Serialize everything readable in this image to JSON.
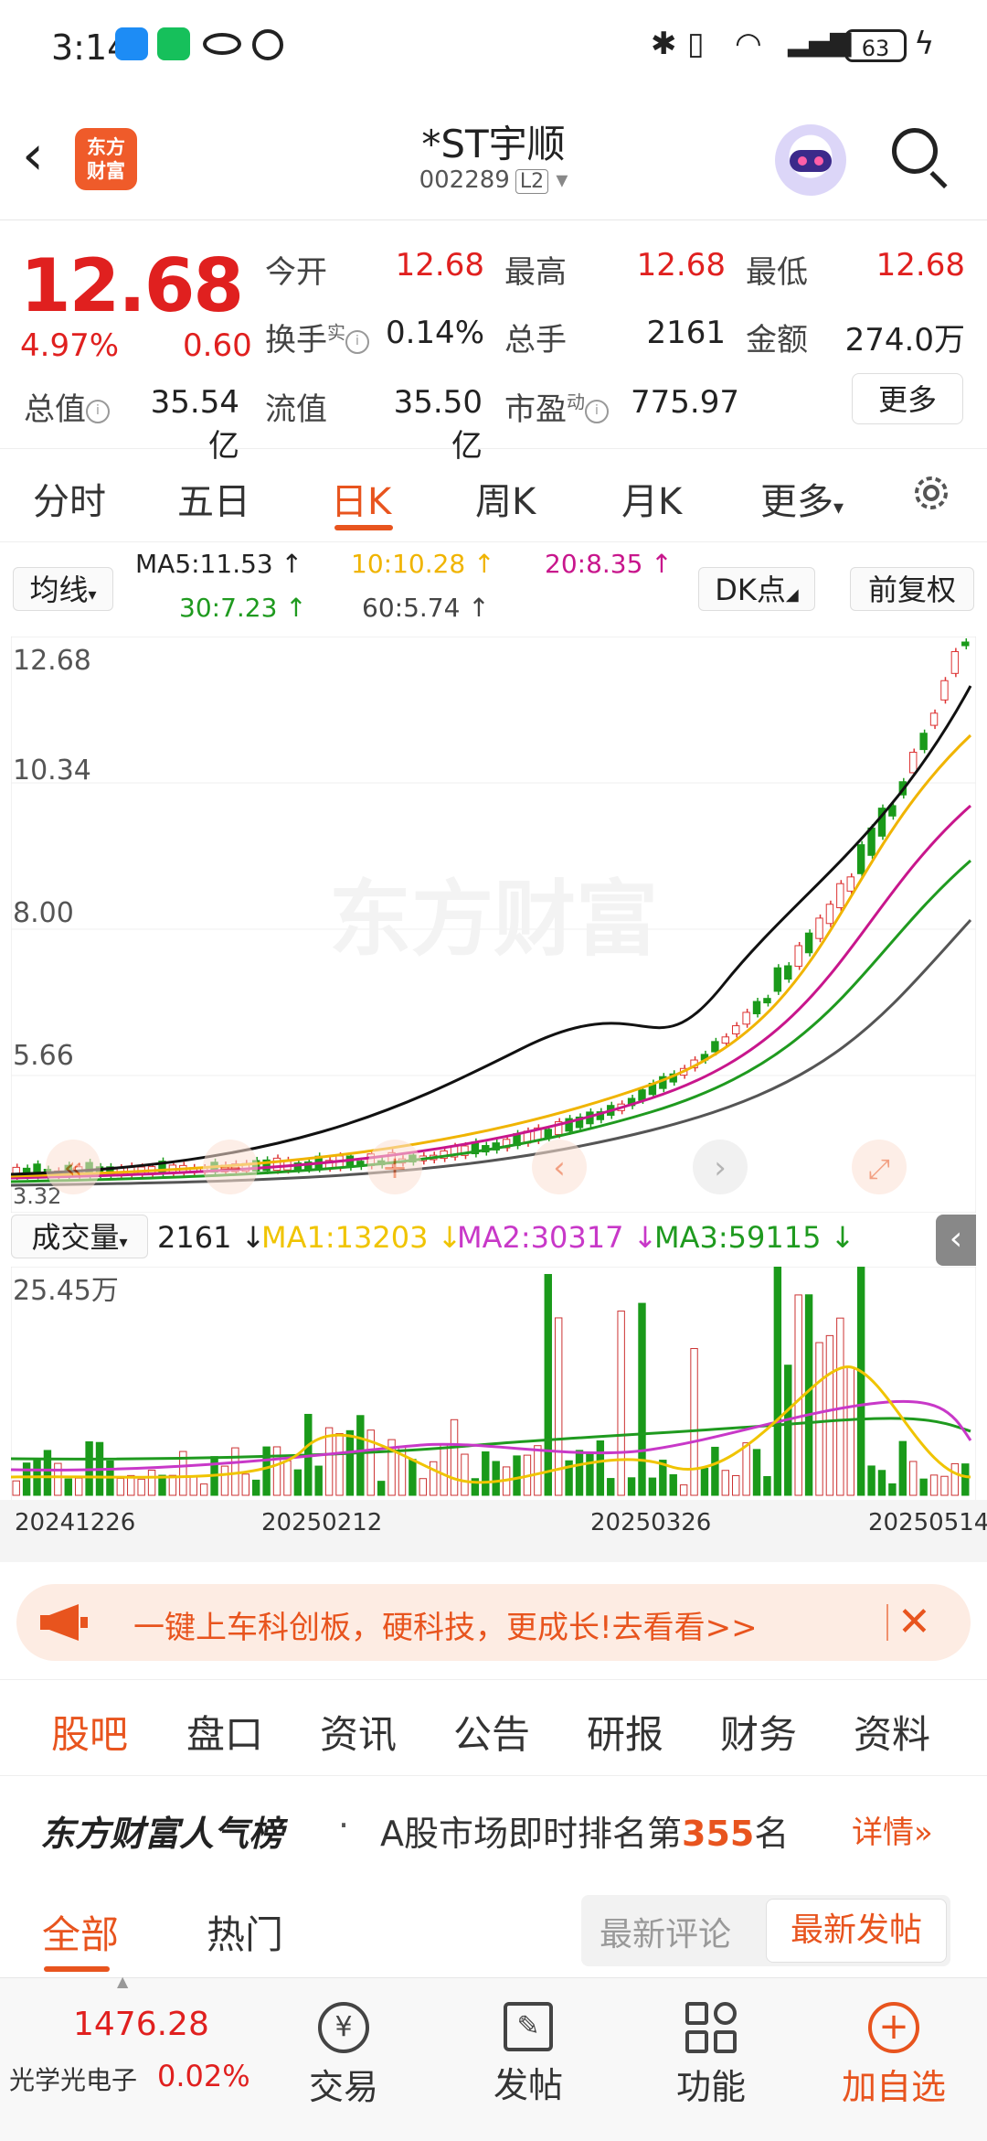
{
  "status_bar": {
    "time": "3:14",
    "battery": "63"
  },
  "header": {
    "back_icon": "chevron-left-icon",
    "logo_text": "东方\n财富",
    "stock_name": "*ST宇顺",
    "stock_code": "002289",
    "level_badge": "L2"
  },
  "quote": {
    "price": "12.68",
    "change_pct": "4.97%",
    "change": "0.60",
    "fields": {
      "open_label": "今开",
      "open": "12.68",
      "high_label": "最高",
      "high": "12.68",
      "low_label": "最低",
      "low": "12.68",
      "turnover_label": "换手",
      "turnover_sup": "实",
      "turnover": "0.14%",
      "volume_label": "总手",
      "volume": "2161",
      "amount_label": "金额",
      "amount": "274.0万",
      "mktcap_label": "总值",
      "mktcap": "35.54亿",
      "float_label": "流值",
      "float_cap": "35.50亿",
      "pe_label": "市盈",
      "pe_sup": "动",
      "pe": "775.97"
    },
    "more_label": "更多"
  },
  "chart_tabs": [
    "分时",
    "五日",
    "日K",
    "周K",
    "月K",
    "更多"
  ],
  "active_chart_tab": "日K",
  "ma_row": {
    "ma_select": "均线",
    "ma5": "MA5:11.53 ↑",
    "ma10": "10:10.28 ↑",
    "ma20": "20:8.35 ↑",
    "ma30": "30:7.23 ↑",
    "ma60": "60:5.74 ↑",
    "dk_button": "DK点",
    "adjust_button": "前复权",
    "colors": {
      "ma5": "#222222",
      "ma10": "#f0b400",
      "ma20": "#c8168c",
      "ma30": "#1f9a1f",
      "ma60": "#555555"
    }
  },
  "kchart": {
    "y_labels": [
      "12.68",
      "10.34",
      "8.00",
      "5.66"
    ],
    "bottom_label": "3.32",
    "watermark": "东方财富"
  },
  "volume": {
    "select": "成交量",
    "current": "2161 ↓",
    "ma1": "MA1:13203 ↓",
    "ma2": "MA2:30317 ↓",
    "ma3": "MA3:59115 ↓",
    "max_label": "25.45万",
    "colors": {
      "ma1": "#f0c400",
      "ma2": "#c838c8",
      "ma3": "#1f9a1f"
    }
  },
  "dates": [
    "20241226",
    "20250212",
    "20250326",
    "20250514"
  ],
  "banner": {
    "text": "一键上车科创板，硬科技，更成长!去看看>>"
  },
  "feature_tabs": [
    "股吧",
    "盘口",
    "资讯",
    "公告",
    "研报",
    "财务",
    "资料"
  ],
  "active_feature_tab": "股吧",
  "rank": {
    "title": "东方财富人气榜",
    "dot": "·",
    "text_before": "A股市场即时排名第",
    "rank": "355",
    "text_after": "名",
    "detail": "详情"
  },
  "sub_tabs": {
    "all": "全部",
    "hot": "热门",
    "latest_comment": "最新评论",
    "latest_post": "最新发帖"
  },
  "bottom_nav": {
    "index_value": "1476.28",
    "index_name": "光学光电子",
    "index_change": "0.02%",
    "items": [
      "交易",
      "发帖",
      "功能",
      "加自选"
    ]
  }
}
